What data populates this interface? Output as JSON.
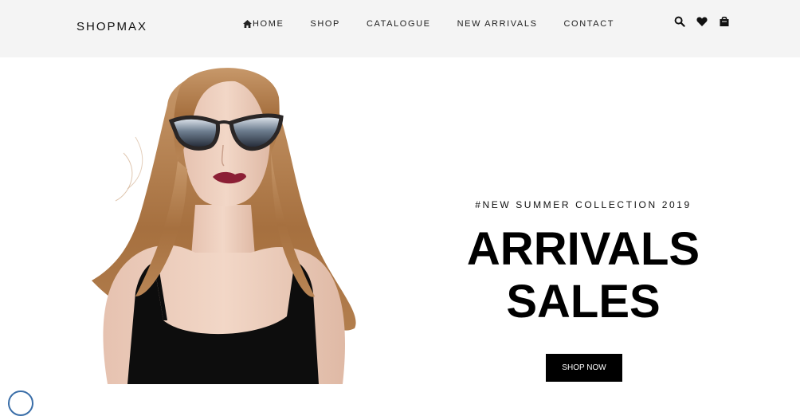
{
  "brand": {
    "logo": "SHOPMAX"
  },
  "nav": {
    "items": [
      {
        "label": "HOME",
        "icon": "home-icon"
      },
      {
        "label": "SHOP"
      },
      {
        "label": "CATALOGUE"
      },
      {
        "label": "NEW ARRIVALS"
      },
      {
        "label": "CONTACT"
      }
    ]
  },
  "header_icons": [
    "search-icon",
    "heart-icon",
    "shopping-bag-icon"
  ],
  "hero": {
    "subtitle": "#NEW SUMMER COLLECTION 2019",
    "title_line1": "ARRIVALS",
    "title_line2": "SALES",
    "cta_label": "SHOP NOW"
  },
  "colors": {
    "header_bg": "#f4f4f4",
    "button_bg": "#000000",
    "button_text": "#ffffff"
  }
}
